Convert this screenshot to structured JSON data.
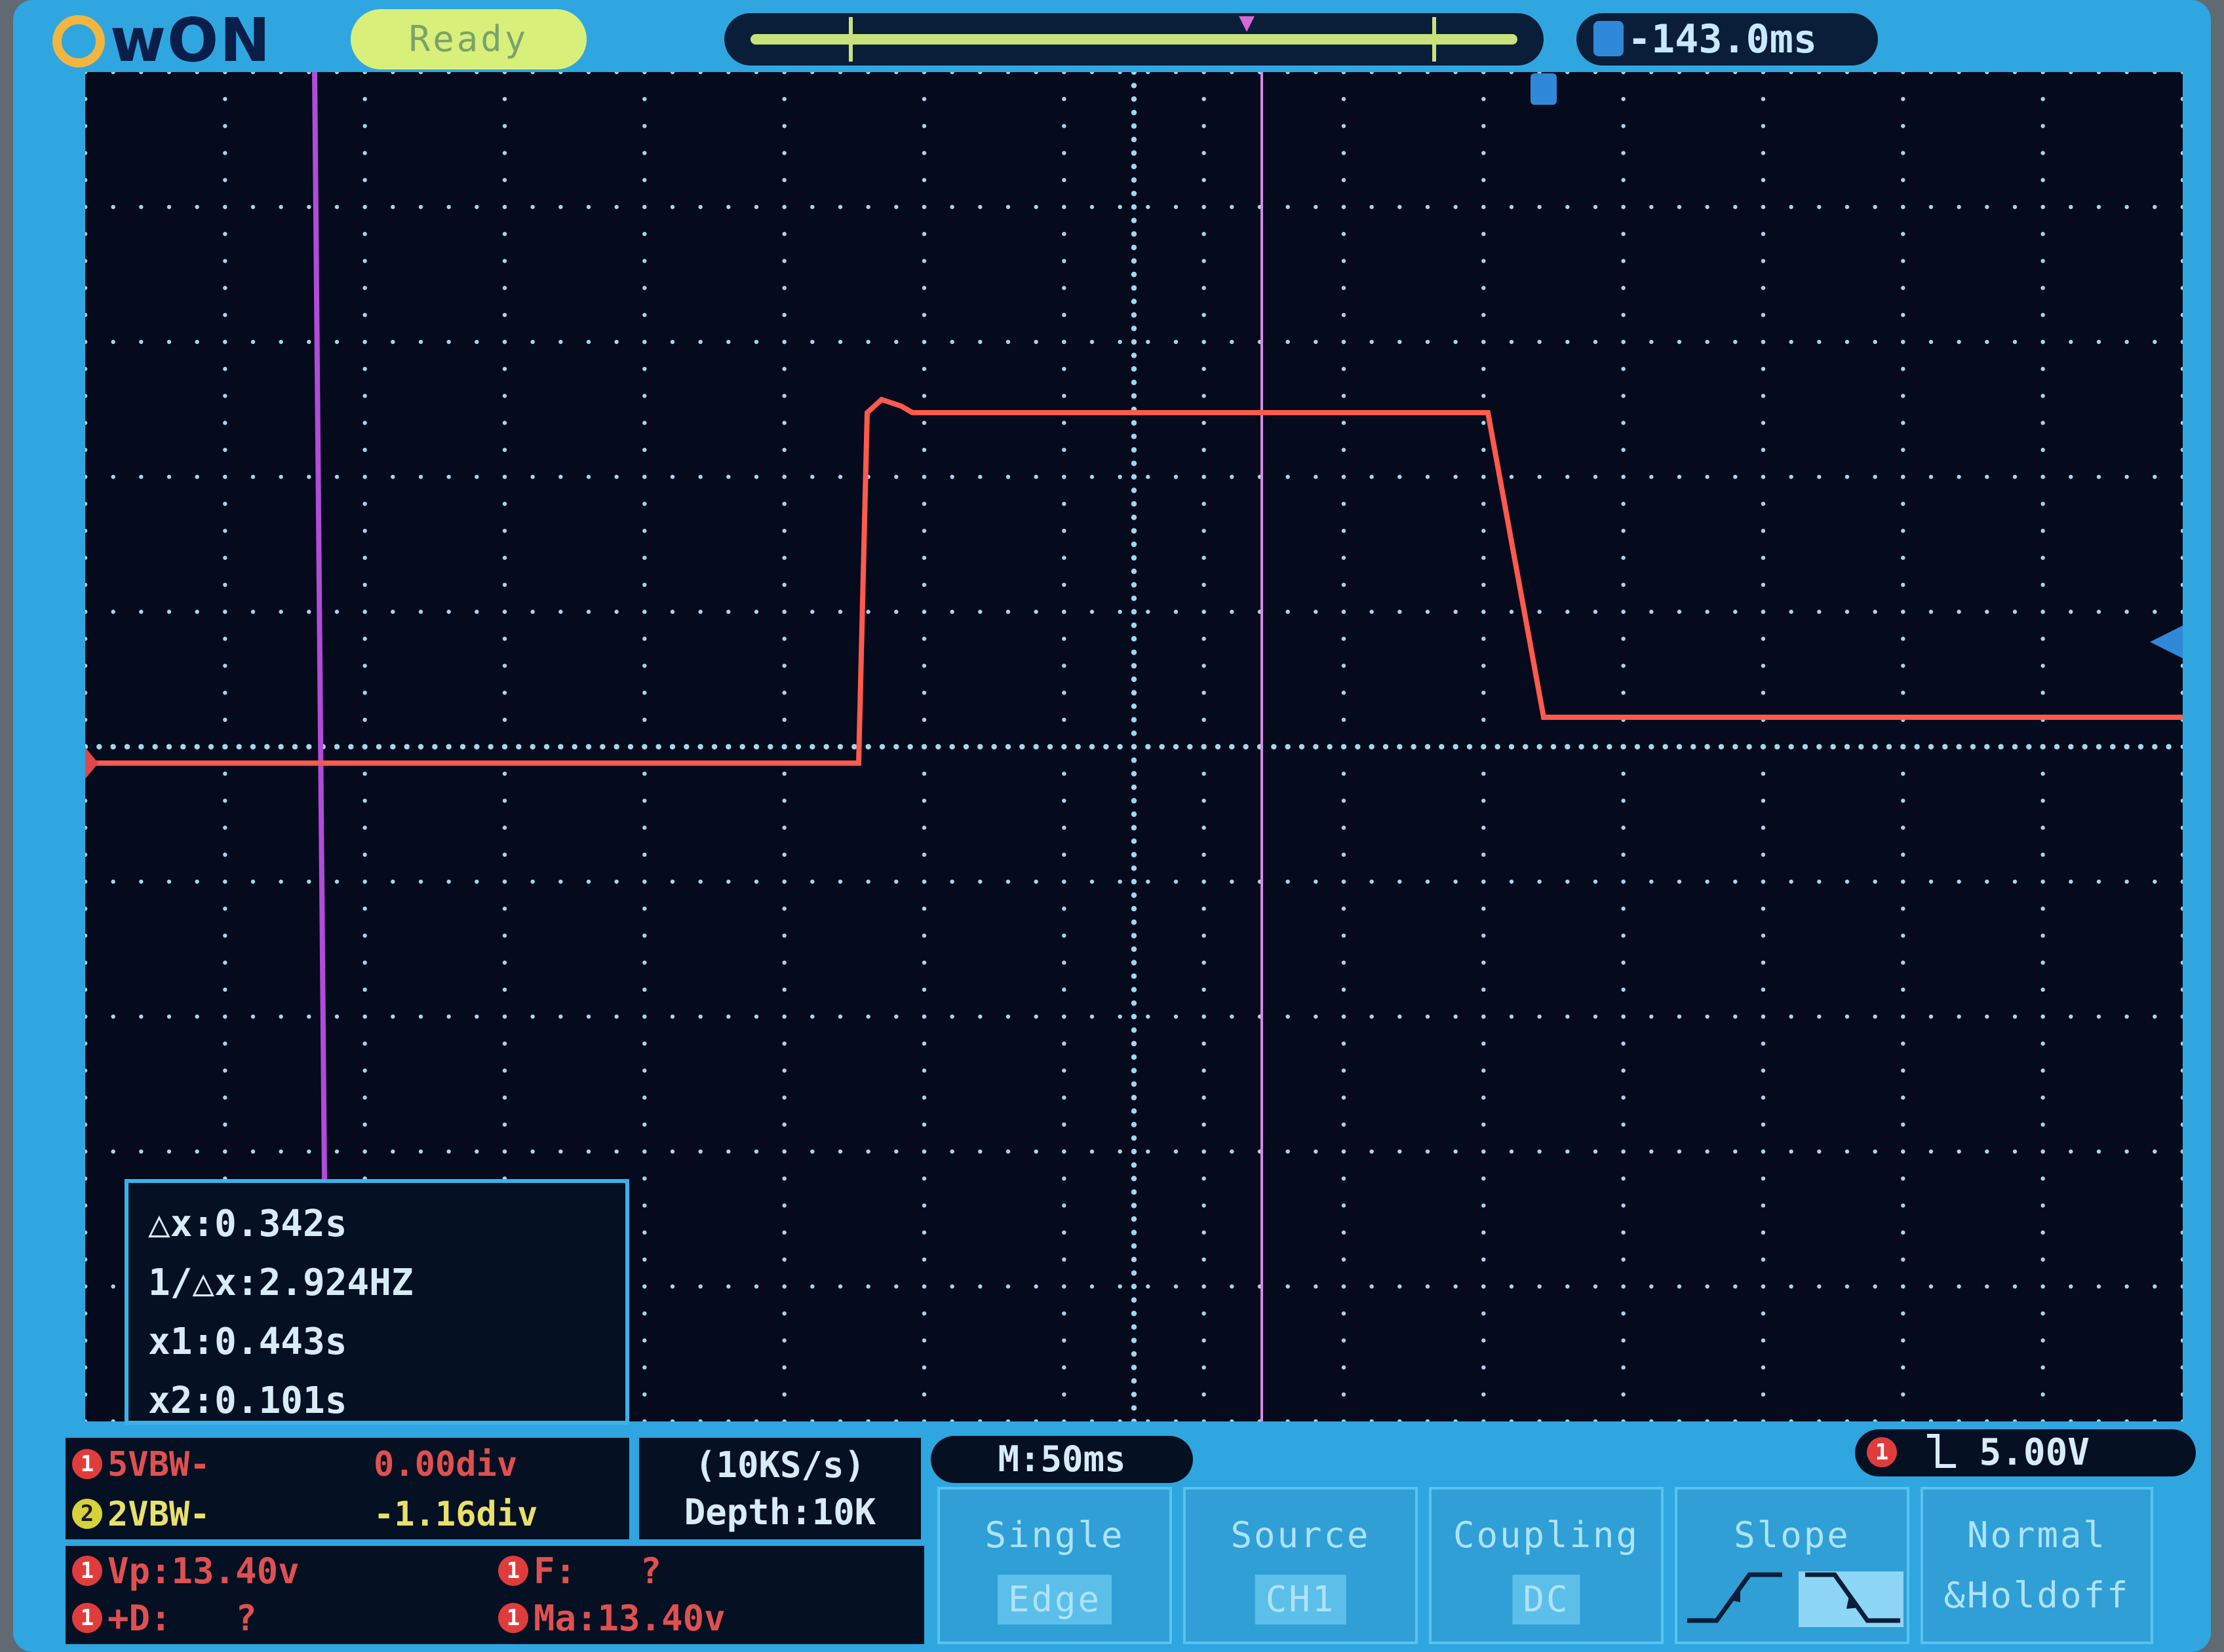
{
  "brand": {
    "name": "wON"
  },
  "status": {
    "label": "Ready"
  },
  "horizontal": {
    "trigger_position": "-143.0ms"
  },
  "cursors": {
    "delta_x": "△x:0.342s",
    "inv_delta_x": "1/△x:2.924HZ",
    "x1": "x1:0.443s",
    "x2": "x2:0.101s"
  },
  "channels": [
    {
      "badge": "1",
      "label": "5VBW-",
      "offset": "0.00div",
      "color": "#e04848"
    },
    {
      "badge": "2",
      "label": "2VBW-",
      "offset": "-1.16div",
      "color": "#e8e06a"
    }
  ],
  "sampling": {
    "rate": "(10KS/s)",
    "depth": "Depth:10K"
  },
  "measurements": [
    {
      "badge": "1",
      "text": "Vp:13.40v"
    },
    {
      "badge": "1",
      "text": "F:   ?"
    },
    {
      "badge": "1",
      "text": "+D:   ?"
    },
    {
      "badge": "1",
      "text": "Ma:13.40v"
    }
  ],
  "timebase": {
    "label": "M:50ms"
  },
  "trigger": {
    "badge": "1",
    "level": "5.00V"
  },
  "softkeys": [
    {
      "title": "Single",
      "value": "Edge"
    },
    {
      "title": "Source",
      "value": "CH1"
    },
    {
      "title": "Coupling",
      "value": "DC"
    },
    {
      "title": "Slope",
      "value": ""
    },
    {
      "title": "Normal",
      "value": "&Holdoff"
    }
  ],
  "channel_marker": "1",
  "trace": {
    "color": "#ff5a4e",
    "cursor_color": "#b04cd8",
    "trigger_cursor_color": "#d48ae0"
  }
}
